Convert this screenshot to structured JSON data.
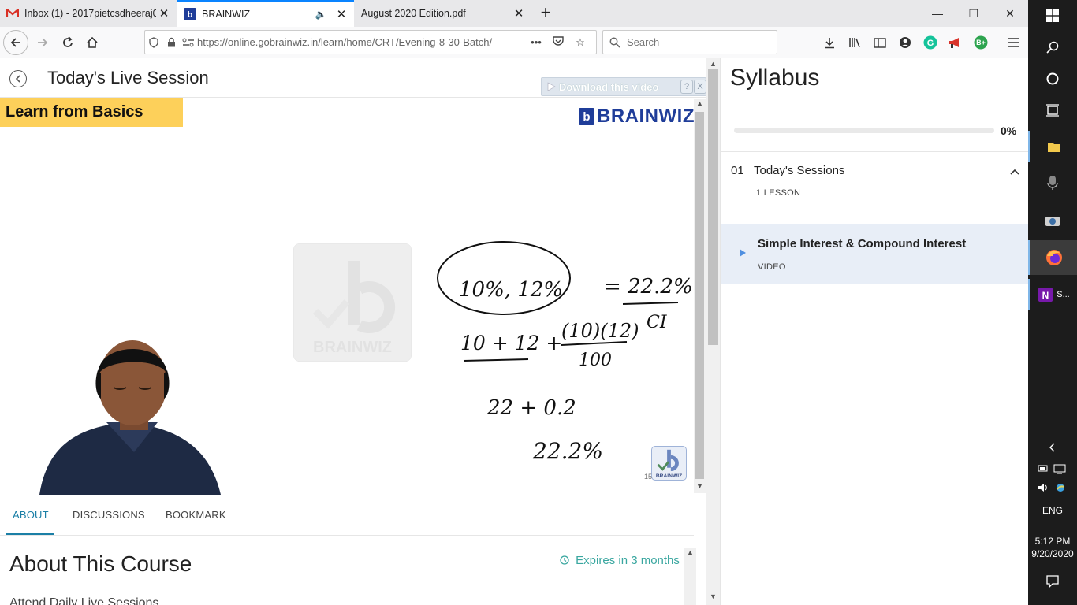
{
  "browser": {
    "tabs": [
      {
        "title": "Inbox (1) - 2017pietcsdheeraj03",
        "favicon": "gmail-icon",
        "active": false
      },
      {
        "title": "BRAINWIZ",
        "favicon": "brainwiz-icon",
        "active": true,
        "audio": true
      },
      {
        "title": "August 2020 Edition.pdf",
        "favicon": "pdf-icon",
        "active": false
      }
    ],
    "url": "https://online.gobrainwiz.in/learn/home/CRT/Evening-8-30-Batch/",
    "url_domain": "gobrainwiz.in",
    "search_placeholder": "Search",
    "extension_badge": "B+"
  },
  "session": {
    "title": "Today's Live Session",
    "download_label": "Download this video",
    "help": "?",
    "close": "X"
  },
  "video": {
    "banner": "Learn from Basics",
    "logo_mark": "b",
    "logo_text": "BRAINWIZ",
    "watermark_text": "BRAINWIZ",
    "corner_number": "15",
    "corner_text": "BRAINWIZ",
    "board": {
      "rates": "10%,     12%",
      "equals": "= 22.2%",
      "formula_sum": "10 + 12 +",
      "numerator": "(10)(12)",
      "denominator": "100",
      "ci": "CI",
      "step2": "22 + 0.2",
      "result": "22.2%"
    }
  },
  "course_tabs": [
    "ABOUT",
    "DISCUSSIONS",
    "BOOKMARK"
  ],
  "about": {
    "heading": "About This Course",
    "expires": "Expires in 3 months",
    "description": "Attend Daily Live Sessions"
  },
  "syllabus": {
    "title": "Syllabus",
    "progress_percent": 0,
    "progress_label": "0%",
    "section_number": "01",
    "section_title": "Today's Sessions",
    "section_count": "1 LESSON",
    "lesson_title": "Simple Interest & Compound Interest",
    "lesson_type": "VIDEO",
    "accent_color": "#3aa7a0",
    "lesson_highlight": "#e8eef7"
  },
  "taskbar": {
    "onenote_label": "S...",
    "language": "ENG",
    "time": "5:12 PM",
    "date": "9/20/2020"
  }
}
